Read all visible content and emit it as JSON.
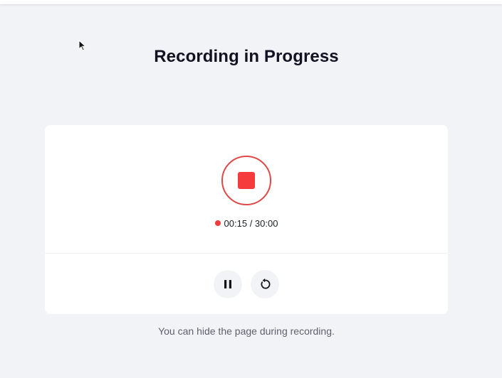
{
  "header": {
    "title": "Recording in Progress"
  },
  "recorder": {
    "elapsed": "00:15",
    "separator": " / ",
    "limit": "30:00",
    "stop_icon": "stop-square-icon",
    "pause_icon": "pause-icon",
    "restart_icon": "restart-icon"
  },
  "footer": {
    "hint": "You can hide the page during recording."
  },
  "colors": {
    "background": "#f2f3f7",
    "card": "#ffffff",
    "accent_red": "#f53b3b",
    "ring_red": "#e04848",
    "title_text": "#111322",
    "hint_text": "#5d616d",
    "control_bg": "#f2f3f6"
  }
}
